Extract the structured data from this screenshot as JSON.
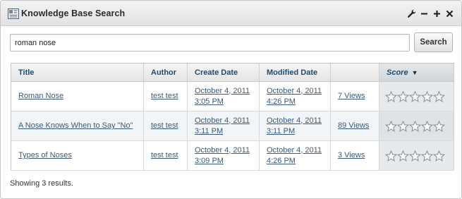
{
  "portlet": {
    "title": "Knowledge Base Search"
  },
  "search": {
    "query": "roman nose",
    "button_label": "Search"
  },
  "table": {
    "headers": {
      "title": "Title",
      "author": "Author",
      "create_date": "Create Date",
      "modified_date": "Modified Date",
      "views": "",
      "score": "Score"
    },
    "sort_indicator": "▼",
    "rows": [
      {
        "title": "Roman Nose",
        "author": "test test",
        "create_date_line1": "October 4, 2011",
        "create_date_line2": "3:05 PM",
        "modified_date_line1": "October 4, 2011",
        "modified_date_line2": "4:26 PM",
        "views": "7 Views",
        "rating": 0
      },
      {
        "title": "A Nose Knows When to Say \"No\"",
        "author": "test test",
        "create_date_line1": "October 4, 2011",
        "create_date_line2": "3:11 PM",
        "modified_date_line1": "October 4, 2011",
        "modified_date_line2": "3:11 PM",
        "views": "89 Views",
        "rating": 0
      },
      {
        "title": "Types of Noses",
        "author": "test test",
        "create_date_line1": "October 4, 2011",
        "create_date_line2": "3:09 PM",
        "modified_date_line1": "October 4, 2011",
        "modified_date_line2": "4:26 PM",
        "views": "3 Views",
        "rating": 0
      }
    ]
  },
  "status": "Showing 3 results.",
  "icons": {
    "portlet_icon": "knowledge-base-icon",
    "configure": "wrench-icon",
    "minimize": "minimize-icon",
    "maximize": "maximize-icon",
    "close": "close-icon",
    "star": "star-outline-icon"
  },
  "colors": {
    "link": "#3b5a77",
    "header_text": "#1f4a70",
    "score_column": "#e6eaed",
    "alt_row": "#f1f5f8"
  }
}
